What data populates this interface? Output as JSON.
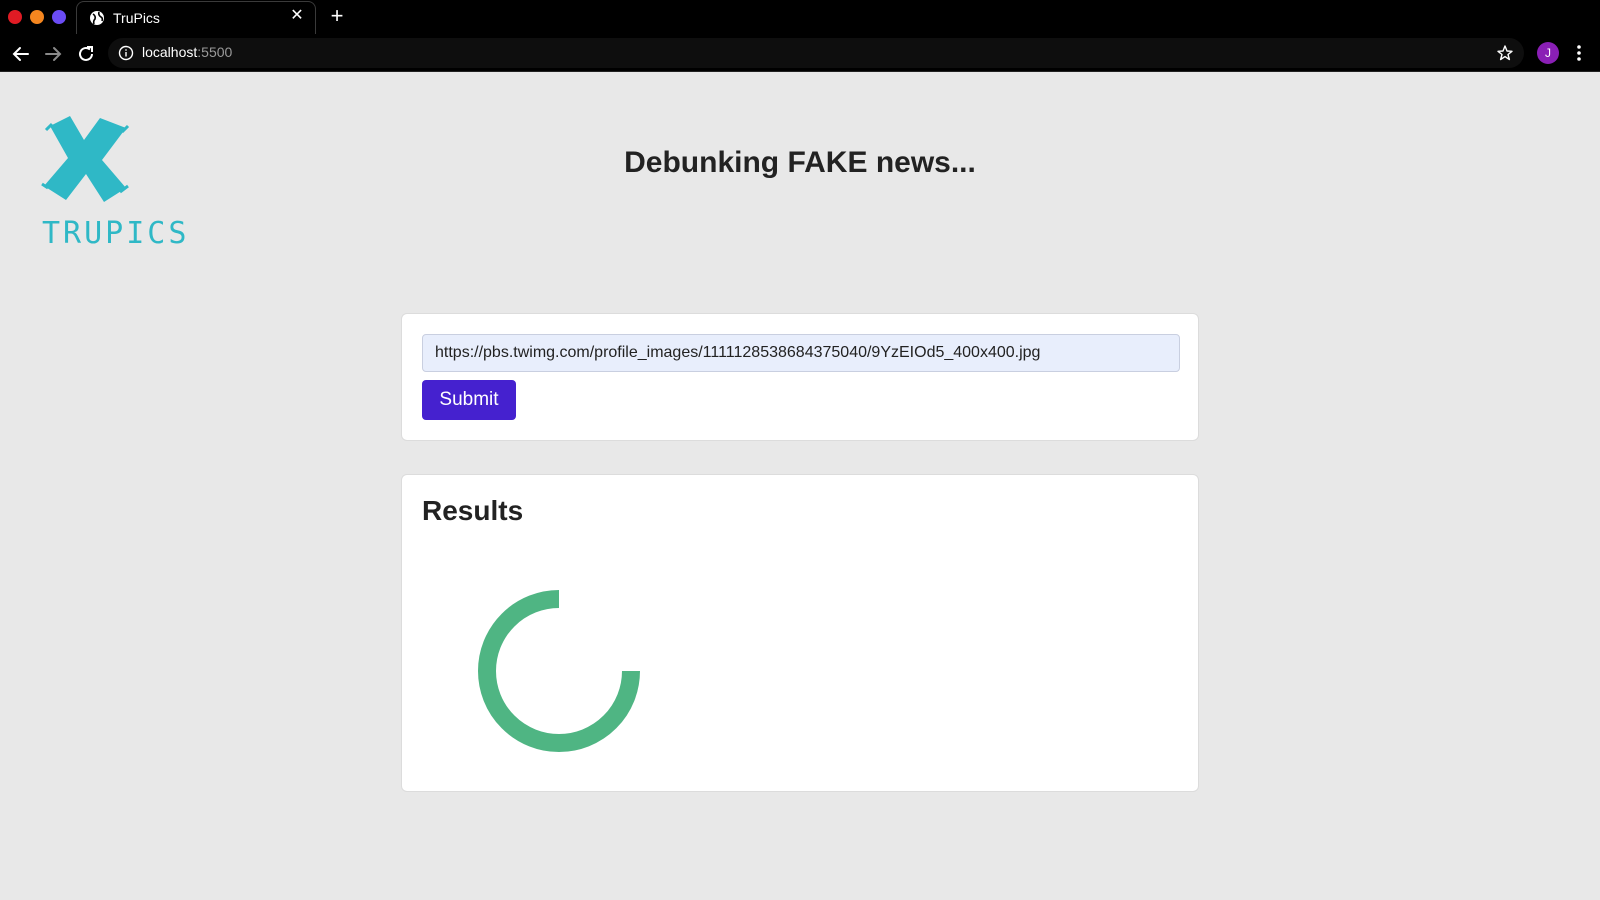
{
  "browser": {
    "tab_title": "TruPics",
    "url_host": "localhost",
    "url_port": ":5500",
    "profile_initial": "J"
  },
  "page": {
    "logo_text": "TRUPICS",
    "headline_pre": "Debunking ",
    "headline_strong": "FAKE",
    "headline_post": " news...",
    "form": {
      "url_value": "https://pbs.twimg.com/profile_images/1111128538684375040/9YzEIOd5_400x400.jpg",
      "submit_label": "Submit"
    },
    "results": {
      "title": "Results"
    }
  },
  "colors": {
    "brand_teal": "#2fb8c6",
    "submit_purple": "#4521cf",
    "spinner_green": "#4fb583"
  },
  "icons": [
    "globe-icon",
    "close-icon",
    "plus-icon",
    "back-arrow-icon",
    "forward-arrow-icon",
    "reload-icon",
    "info-icon",
    "star-icon",
    "more-vert-icon",
    "x-logo-icon",
    "loading-spinner-icon"
  ]
}
